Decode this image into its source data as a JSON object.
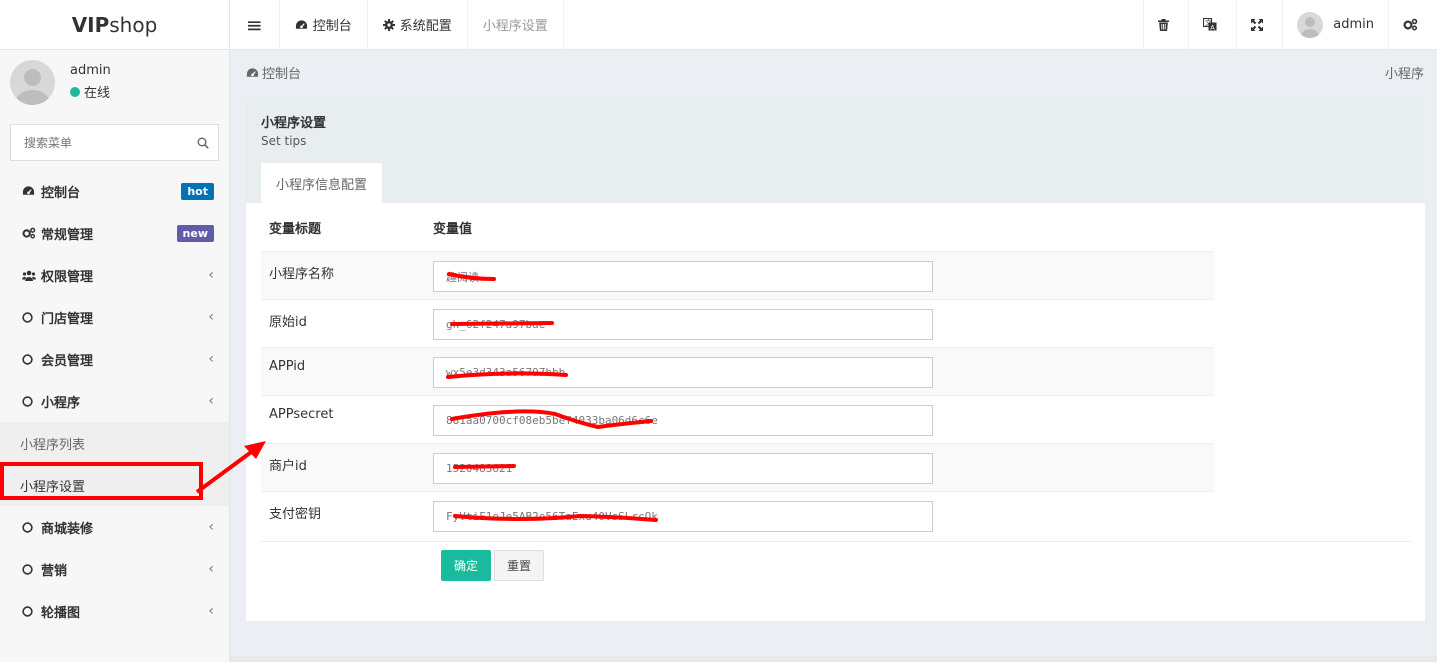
{
  "brand": {
    "bold": "VIP",
    "light": "shop"
  },
  "topbar": {
    "menu_toggle": "≡",
    "tabs": [
      {
        "label": "控制台",
        "icon": "dashboard-icon"
      },
      {
        "label": "系统配置",
        "icon": "gear-icon"
      },
      {
        "label": "小程序设置",
        "icon": ""
      }
    ],
    "right_icons": [
      "trash-icon",
      "translate-icon",
      "fullscreen-icon"
    ],
    "user": "admin",
    "settings_icon": "cogs-icon"
  },
  "sidebar": {
    "user": {
      "name": "admin",
      "status": "在线"
    },
    "search_placeholder": "搜索菜单",
    "items": [
      {
        "label": "控制台",
        "icon": "dashboard-icon",
        "badge": "hot",
        "badge_color": "#0073b7"
      },
      {
        "label": "常规管理",
        "icon": "cogs-icon",
        "badge": "new",
        "badge_color": "#605ca8"
      },
      {
        "label": "权限管理",
        "icon": "users-icon",
        "chevron": "‹"
      },
      {
        "label": "门店管理",
        "icon": "circle-icon",
        "chevron": "‹"
      },
      {
        "label": "会员管理",
        "icon": "circle-icon",
        "chevron": "‹"
      },
      {
        "label": "小程序",
        "icon": "circle-icon",
        "chevron": "‹"
      }
    ],
    "sub_items": [
      {
        "label": "小程序列表"
      },
      {
        "label": "小程序设置"
      }
    ],
    "items_after": [
      {
        "label": "商城装修",
        "icon": "circle-icon",
        "chevron": "‹"
      },
      {
        "label": "营销",
        "icon": "circle-icon",
        "chevron": "‹"
      },
      {
        "label": "轮播图",
        "icon": "circle-icon",
        "chevron": "‹"
      }
    ]
  },
  "breadcrumb": {
    "home": "控制台",
    "right": "小程序"
  },
  "panel": {
    "title": "小程序设置",
    "subtitle": "Set tips",
    "tab": "小程序信息配置",
    "col_title": "变量标题",
    "col_value": "变量值",
    "rows": [
      {
        "label": "小程序名称",
        "value": "趣阅读"
      },
      {
        "label": "原始id",
        "value": "gh_62f247a97bae"
      },
      {
        "label": "APPid",
        "value": "wx5e3d343a56797bbb"
      },
      {
        "label": "APPsecret",
        "value": "881aa0700cf08eb5bef4033ba06d6c6e"
      },
      {
        "label": "商户id",
        "value": "1520483621"
      },
      {
        "label": "支付密钥",
        "value": "FyVtiF1eJe5AB2e56TaExu40VsSLrcOk"
      }
    ],
    "ok_label": "确定",
    "reset_label": "重置"
  },
  "colors": {
    "accent": "#18bc9c",
    "annotation": "#ff0000"
  }
}
